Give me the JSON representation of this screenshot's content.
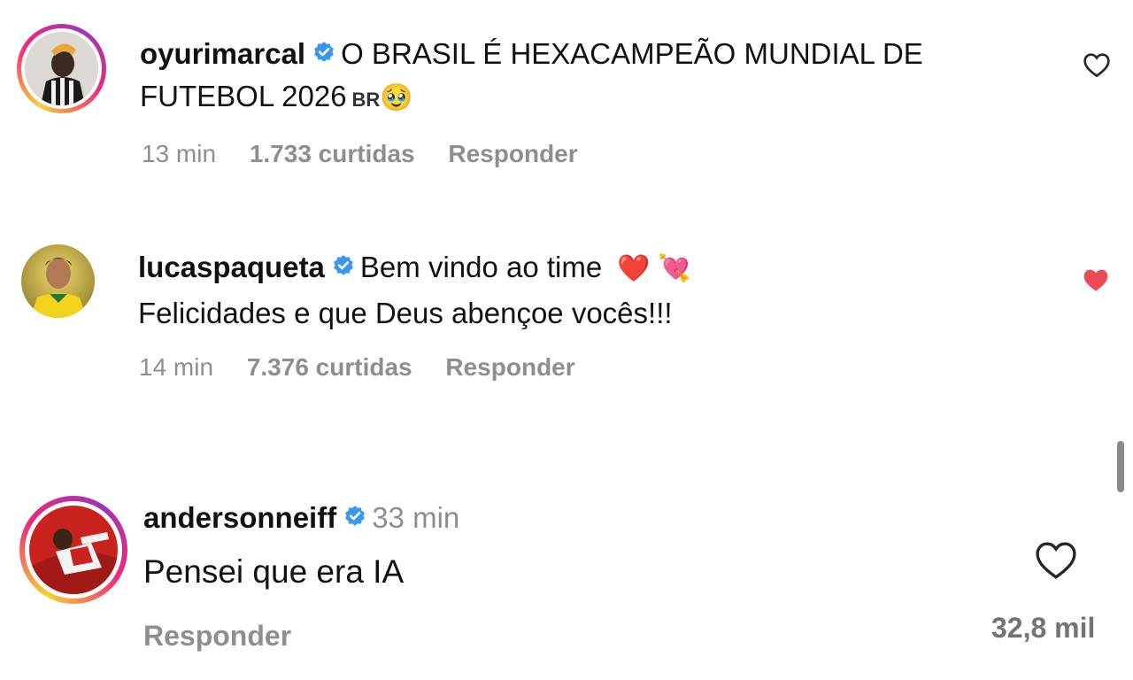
{
  "comments": [
    {
      "username": "oyurimarcal",
      "text_line1": "O BRASIL É HEXACAMPEÃO MUNDIAL DE",
      "text_line2": "FUTEBOL 2026",
      "flag_text": "BR",
      "emoji": "🥹",
      "time": "13 min",
      "likes": "1.733 curtidas",
      "reply_label": "Responder",
      "liked": false
    },
    {
      "username": "lucaspaqueta",
      "text_line1": "Bem vindo ao time",
      "emoji_line1": "❤️ 💘",
      "text_line2": "Felicidades e que Deus abençoe vocês!!!",
      "time": "14 min",
      "likes": "7.376 curtidas",
      "reply_label": "Responder",
      "liked": true
    },
    {
      "username": "andersonneiff",
      "time": "33 min",
      "text_line1": "Pensei que era IA",
      "reply_label": "Responder",
      "like_count": "32,8 mil",
      "liked": false
    }
  ],
  "colors": {
    "verified": "#3897f0",
    "liked_heart": "#ed4956",
    "meta_text": "#8e8e8e"
  },
  "icons": {
    "verified": "verified-badge-icon",
    "like": "heart-icon"
  }
}
